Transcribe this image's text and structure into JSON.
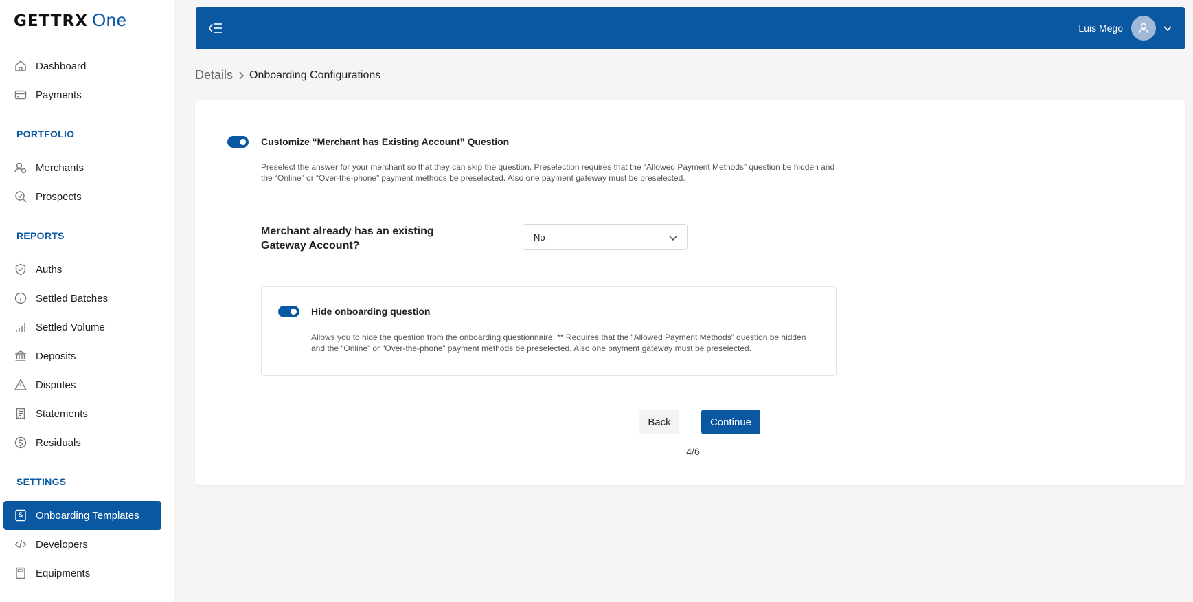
{
  "brand": {
    "name": "GETTRX",
    "suffix": "One"
  },
  "sidebar": {
    "top_items": [
      {
        "label": "Dashboard",
        "icon": "home-icon"
      },
      {
        "label": "Payments",
        "icon": "card-icon"
      }
    ],
    "sections": {
      "portfolio": "PORTFOLIO",
      "reports": "REPORTS",
      "settings": "SETTINGS"
    },
    "portfolio_items": [
      {
        "label": "Merchants",
        "icon": "merchants-icon"
      },
      {
        "label": "Prospects",
        "icon": "prospects-icon"
      }
    ],
    "reports_items": [
      {
        "label": "Auths",
        "icon": "shield-check-icon"
      },
      {
        "label": "Settled Batches",
        "icon": "info-icon"
      },
      {
        "label": "Settled Volume",
        "icon": "bar-chart-icon"
      },
      {
        "label": "Deposits",
        "icon": "bank-icon"
      },
      {
        "label": "Disputes",
        "icon": "warning-icon"
      },
      {
        "label": "Statements",
        "icon": "receipt-icon"
      },
      {
        "label": "Residuals",
        "icon": "dollar-circle-icon"
      }
    ],
    "settings_items": [
      {
        "label": "Onboarding Templates",
        "icon": "dollar-document-icon",
        "active": true
      },
      {
        "label": "Developers",
        "icon": "code-icon"
      },
      {
        "label": "Equipments",
        "icon": "terminal-icon"
      }
    ]
  },
  "topbar": {
    "user_name": "Luis Mego"
  },
  "breadcrumb": {
    "first": "Details",
    "current": "Onboarding Configurations"
  },
  "card": {
    "customize": {
      "title": "Customize “Merchant has Existing Account” Question",
      "description": "Preselect the answer for your merchant so that they can skip the question. Preselection requires that the “Allowed Payment Methods” question be hidden and the “Online” or “Over-the-phone” payment methods be preselected. Also one payment gateway must be preselected.",
      "enabled": true
    },
    "field": {
      "label": "Merchant already has an existing Gateway Account?",
      "value": "No"
    },
    "hide": {
      "title": "Hide onboarding question",
      "description": "Allows you to hide the question from the onboarding questionnaire. ** Requires that the “Allowed Payment Methods” question be hidden and the “Online” or “Over-the-phone” payment methods be preselected. Also one payment gateway must be preselected.",
      "enabled": true
    },
    "buttons": {
      "back": "Back",
      "continue": "Continue"
    },
    "step": "4/6"
  },
  "colors": {
    "primary": "#0a58a1",
    "background": "#f5f5f5"
  }
}
